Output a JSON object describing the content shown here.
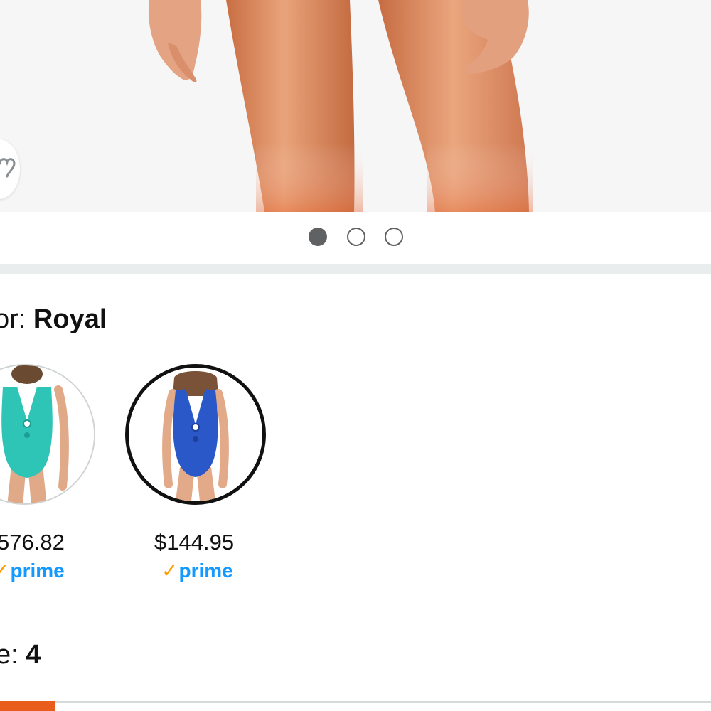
{
  "product_image": {
    "alt": "Model wearing swimsuit (legs)",
    "carousel": {
      "slide_count": 3,
      "active_index": 0
    }
  },
  "wishlist": {
    "icon": "heart-outline-icon"
  },
  "color": {
    "label": "or: ",
    "selected": "Royal",
    "options": [
      {
        "name": "Turquoise",
        "price": "$76.82",
        "price_visible": "576.82",
        "prime": "prime",
        "swatch_color": "#2ec4b6",
        "selected": false
      },
      {
        "name": "Royal",
        "price": "$144.95",
        "prime": "prime",
        "swatch_color": "#2a58c8",
        "selected": true
      }
    ]
  },
  "size": {
    "label": "e: ",
    "value": "4"
  },
  "colors": {
    "prime_blue": "#1399ff",
    "prime_check": "#ff9900",
    "accent_orange": "#e85d1b",
    "dot_gray": "#5f6163"
  }
}
